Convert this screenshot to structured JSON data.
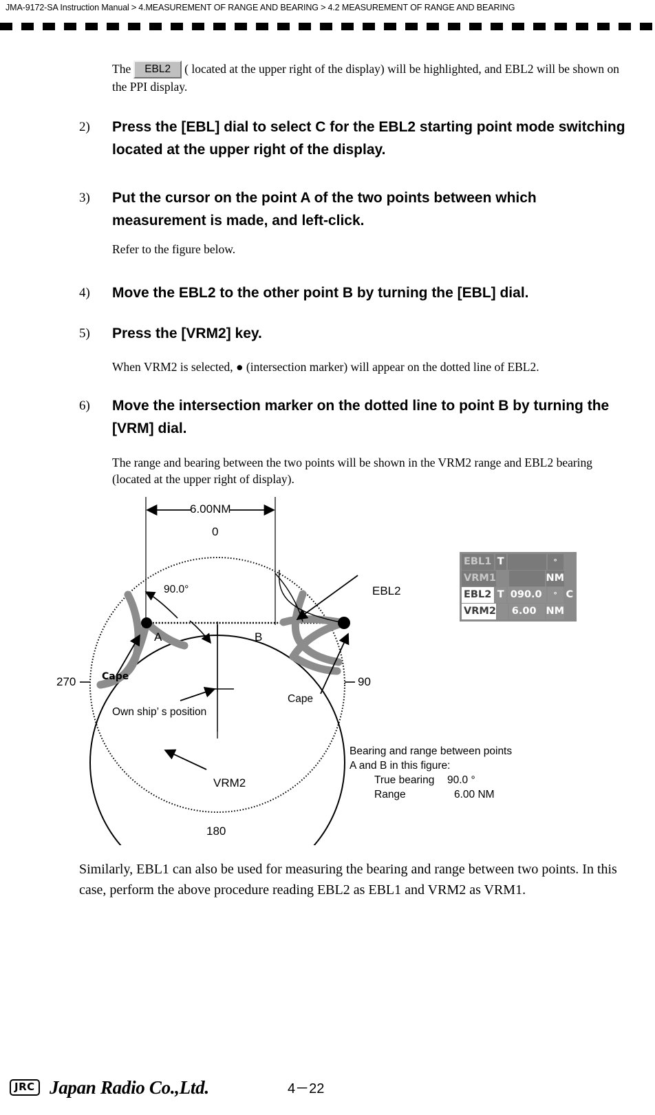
{
  "header": {
    "manual": "JMA-9172-SA Instruction Manual",
    "sep": ">",
    "chapter": "4.MEASUREMENT OF RANGE AND BEARING",
    "section": "4.2  MEASUREMENT OF RANGE AND BEARING"
  },
  "intro": {
    "before": "The",
    "button_label": "EBL2",
    "after": "( located at the upper right of the display) will be highlighted, and EBL2 will be shown on the PPI display."
  },
  "steps": [
    {
      "num": "2)",
      "text": "Press the [EBL] dial to select  C  for the EBL2 starting point mode switching located at the upper right of the display."
    },
    {
      "num": "3)",
      "text": "Put the cursor on the point A of the two points between which measurement is made, and left-click."
    },
    {
      "num": "4)",
      "text": "Move the EBL2 to the other point B by turning the [EBL] dial."
    },
    {
      "num": "5)",
      "text": "Press the [VRM2] key."
    },
    {
      "num": "6)",
      "text": " Move the intersection marker on the dotted line to point B by turning the [VRM] dial."
    }
  ],
  "notes": {
    "refer": "Refer to the figure below.",
    "vrm2_note": "When VRM2 is selected, ● (intersection marker) will appear on the dotted line of EBL2.",
    "range_bearing_note": "The range and bearing between the two points will be shown in the VRM2 range and EBL2 bearing (located at the upper right of display)."
  },
  "figure": {
    "range_dimension": "6.00NM",
    "bearing_0": "0",
    "bearing_90": "90",
    "bearing_180": "180",
    "bearing_270": "270",
    "angle_annotation": "90.0°",
    "point_a": "A",
    "point_b": "B",
    "cape_left": "Cape",
    "cape_right": "Cape",
    "own_ship": "Own ship’ s position",
    "ebl2_label": "EBL2",
    "vrm2_label": "VRM2",
    "summary": {
      "line1": "Bearing and range between points",
      "line2": "A and B in this figure:",
      "bearing_label": "True bearing",
      "bearing_value": "90.0 °",
      "range_label": "Range",
      "range_value": "6.00 NM"
    }
  },
  "radar_panel": {
    "rows": [
      {
        "name": "EBL1",
        "mode": "T",
        "value": "",
        "unit": "",
        "suffix": "",
        "active": false,
        "degree": true
      },
      {
        "name": "VRM1",
        "mode": "",
        "value": "",
        "unit": "NM",
        "suffix": "",
        "active": false,
        "degree": false
      },
      {
        "name": "EBL2",
        "mode": "T",
        "value": "090.0",
        "unit": "",
        "suffix": "C",
        "active": true,
        "degree": true
      },
      {
        "name": "VRM2",
        "mode": "",
        "value": "6.00",
        "unit": "NM",
        "suffix": "",
        "active": true,
        "degree": false
      }
    ]
  },
  "closing": "Similarly, EBL1 can also be used for measuring the bearing and range between two points. In this case, perform the above procedure reading EBL2 as EBL1 and VRM2 as VRM1.",
  "footer": {
    "logo": "JRC",
    "company": "Japan Radio Co.,Ltd.",
    "page": "4－22"
  }
}
